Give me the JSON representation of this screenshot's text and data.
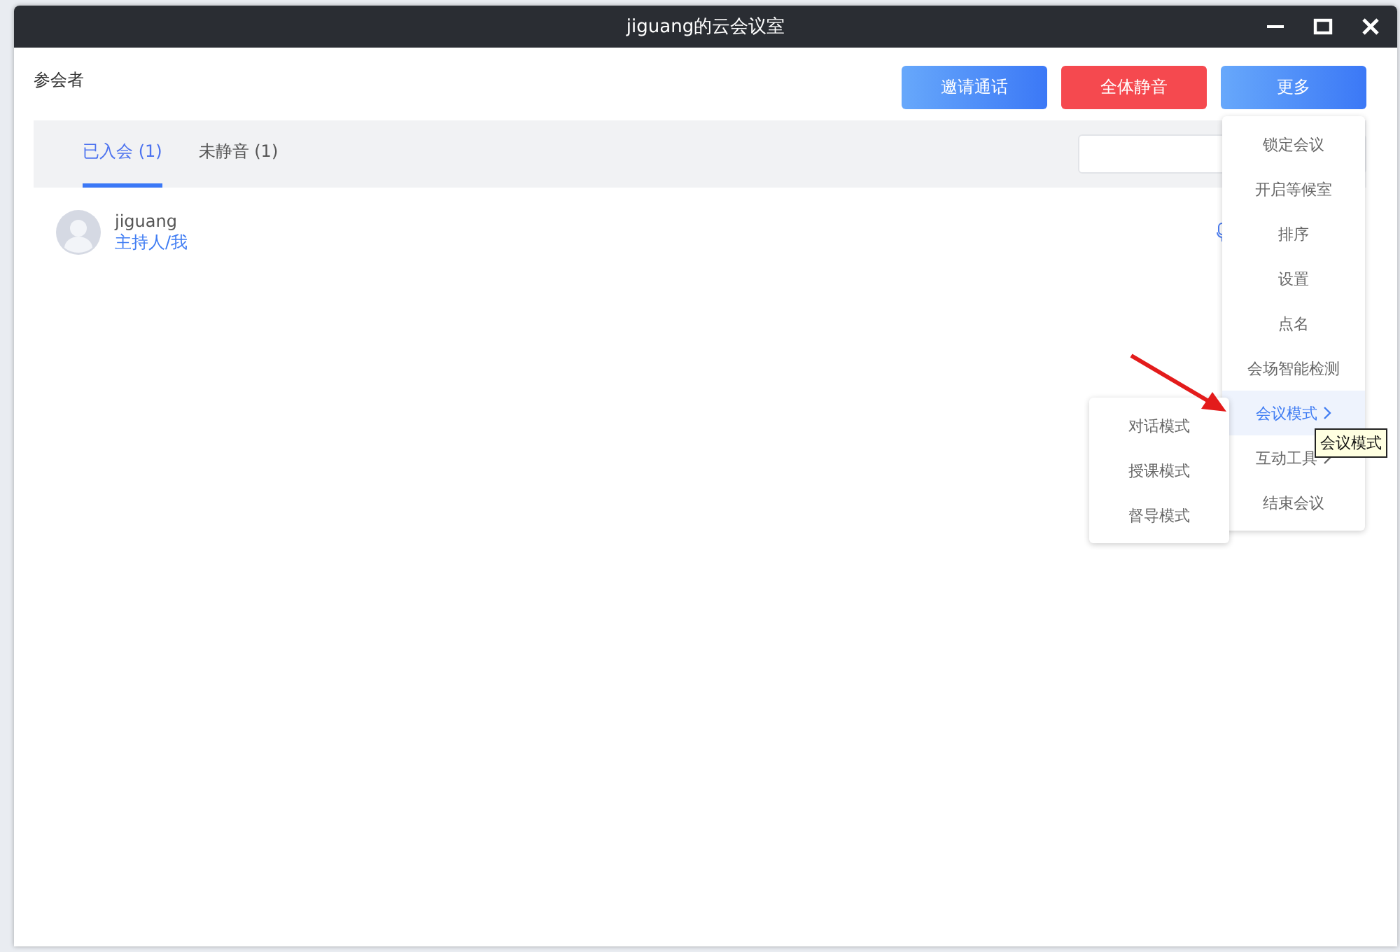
{
  "window": {
    "title": "jiguang的云会议室"
  },
  "header": {
    "label": "参会者"
  },
  "buttons": [
    {
      "label": "邀请通话",
      "kind": "primary"
    },
    {
      "label": "全体静音",
      "kind": "danger"
    },
    {
      "label": "更多",
      "kind": "primary"
    }
  ],
  "tabs": [
    {
      "label": "已入会",
      "count": "(1)",
      "selected": true
    },
    {
      "label": "未静音",
      "count": "(1)",
      "selected": false
    }
  ],
  "participants": [
    {
      "name": "jiguang",
      "role": "主持人/我"
    }
  ],
  "menu": {
    "items": [
      {
        "label": "锁定会议",
        "highlighted": false,
        "has_submenu": false
      },
      {
        "label": "开启等候室",
        "highlighted": false,
        "has_submenu": false
      },
      {
        "label": "排序",
        "highlighted": false,
        "has_submenu": false
      },
      {
        "label": "设置",
        "highlighted": false,
        "has_submenu": false
      },
      {
        "label": "点名",
        "highlighted": false,
        "has_submenu": false
      },
      {
        "label": "会场智能检测",
        "highlighted": false,
        "has_submenu": false
      },
      {
        "label": "会议模式",
        "highlighted": true,
        "has_submenu": true
      },
      {
        "label": "互动工具",
        "highlighted": false,
        "has_submenu": true
      },
      {
        "label": "结束会议",
        "highlighted": false,
        "has_submenu": false
      }
    ]
  },
  "submenu": {
    "items": [
      {
        "label": "对话模式"
      },
      {
        "label": "授课模式"
      },
      {
        "label": "督导模式"
      }
    ]
  },
  "tooltip": {
    "text": "会议模式"
  }
}
